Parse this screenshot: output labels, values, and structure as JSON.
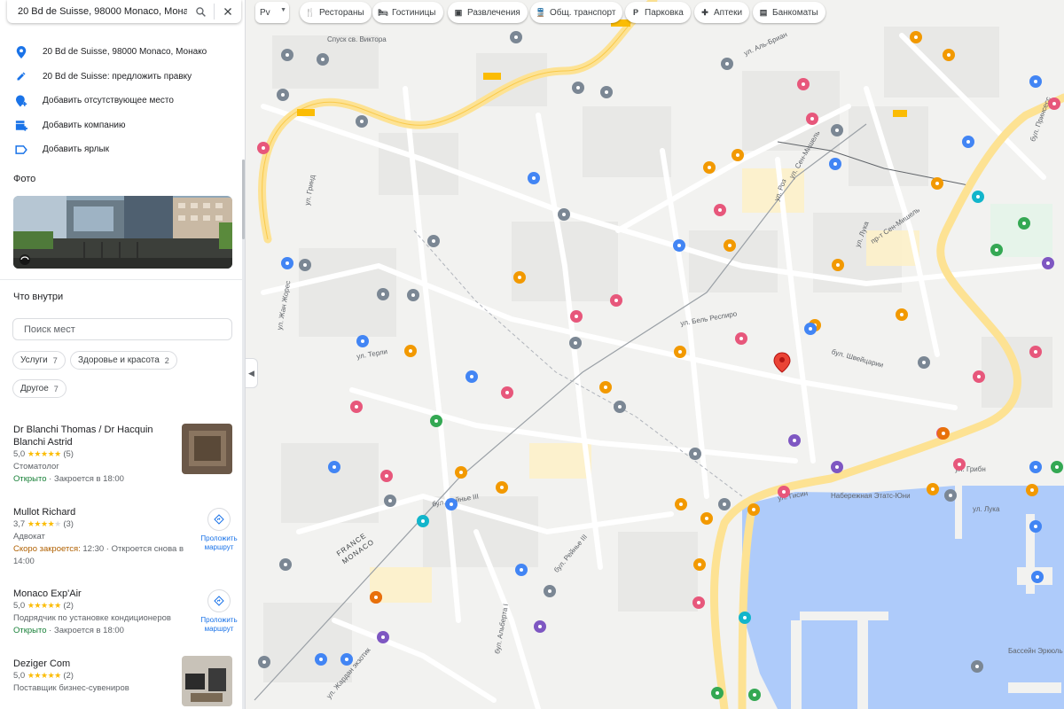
{
  "search": {
    "query": "20 Bd de Suisse, 98000 Monaco, Мона"
  },
  "actions": [
    {
      "icon": "location-pin-icon",
      "label": "20 Bd de Suisse, 98000 Monaco, Монако"
    },
    {
      "icon": "pencil-icon",
      "label": "20 Bd de Suisse: предложить правку"
    },
    {
      "icon": "add-place-icon",
      "label": "Добавить отсутствующее место"
    },
    {
      "icon": "add-business-icon",
      "label": "Добавить компанию"
    },
    {
      "icon": "label-icon",
      "label": "Добавить ярлык"
    }
  ],
  "photos": {
    "title": "Фото"
  },
  "inside": {
    "title": "Что внутри",
    "search_placeholder": "Поиск мест",
    "filters": [
      {
        "label": "Услуги",
        "count": "7"
      },
      {
        "label": "Здоровье и красота",
        "count": "2"
      },
      {
        "label": "Другое",
        "count": "7"
      }
    ]
  },
  "businesses": [
    {
      "name": "Dr Blanchi Thomas / Dr Hacquin Blanchi Astrid",
      "rating": "5,0",
      "stars": 5,
      "reviews": "(5)",
      "category": "Стоматолог",
      "status": "Открыто",
      "hours": " · Закроется в 18:00",
      "has_photo": true
    },
    {
      "name": "Mullot Richard",
      "rating": "3,7",
      "stars": 4,
      "reviews": "(3)",
      "category": "Адвокат",
      "status": "Скоро закроется:",
      "hours": " 12:30 · Откроется снова в",
      "hours2": "14:00",
      "route_label": "Проложить маршрут"
    },
    {
      "name": "Monaco Exp'Air",
      "rating": "5,0",
      "stars": 5,
      "reviews": "(2)",
      "category": "Подрядчик по установке кондиционеров",
      "status": "Открыто",
      "hours": " · Закроется в 18:00",
      "route_label": "Проложить маршрут"
    },
    {
      "name": "Deziger Com",
      "rating": "5,0",
      "stars": 5,
      "reviews": "(2)",
      "category": "Поставщик бизнес-сувениров",
      "has_photo": true
    }
  ],
  "map": {
    "layer_label": "Рv",
    "categories": [
      {
        "icon": "restaurant-icon",
        "label": "Рестораны"
      },
      {
        "icon": "hotel-icon",
        "label": "Гостиницы"
      },
      {
        "icon": "entertainment-icon",
        "label": "Развлечения"
      },
      {
        "icon": "transit-icon",
        "label": "Общ. транспорт"
      },
      {
        "icon": "parking-icon",
        "label": "Парковка"
      },
      {
        "icon": "pharmacy-icon",
        "label": "Аптеки"
      },
      {
        "icon": "atm-icon",
        "label": "Банкоматы"
      }
    ],
    "street_labels": [
      "Спуск св. Виктора",
      "ул. Аль-Бриан",
      "ул. Сен-Мишель",
      "ул. Роз",
      "ул. Лука",
      "пр-т Сен-Мишель",
      "бул. Принсесс",
      "бул. Швейцарии",
      "ул. Бель Респиро",
      "ул. Гринд",
      "ул. Терли",
      "ул. Жан Жорес",
      "бул. Рейнье III",
      "ул. Грибн",
      "ул. Лука",
      "ул. Гисин",
      "Набережная Этатс-Юни",
      "ул. Жардан экзотик",
      "бул. Рейнье III",
      "бул. Альберта I",
      "Бассейн Эркюль"
    ],
    "border_label": [
      "FRANCE",
      "MONACO"
    ]
  }
}
